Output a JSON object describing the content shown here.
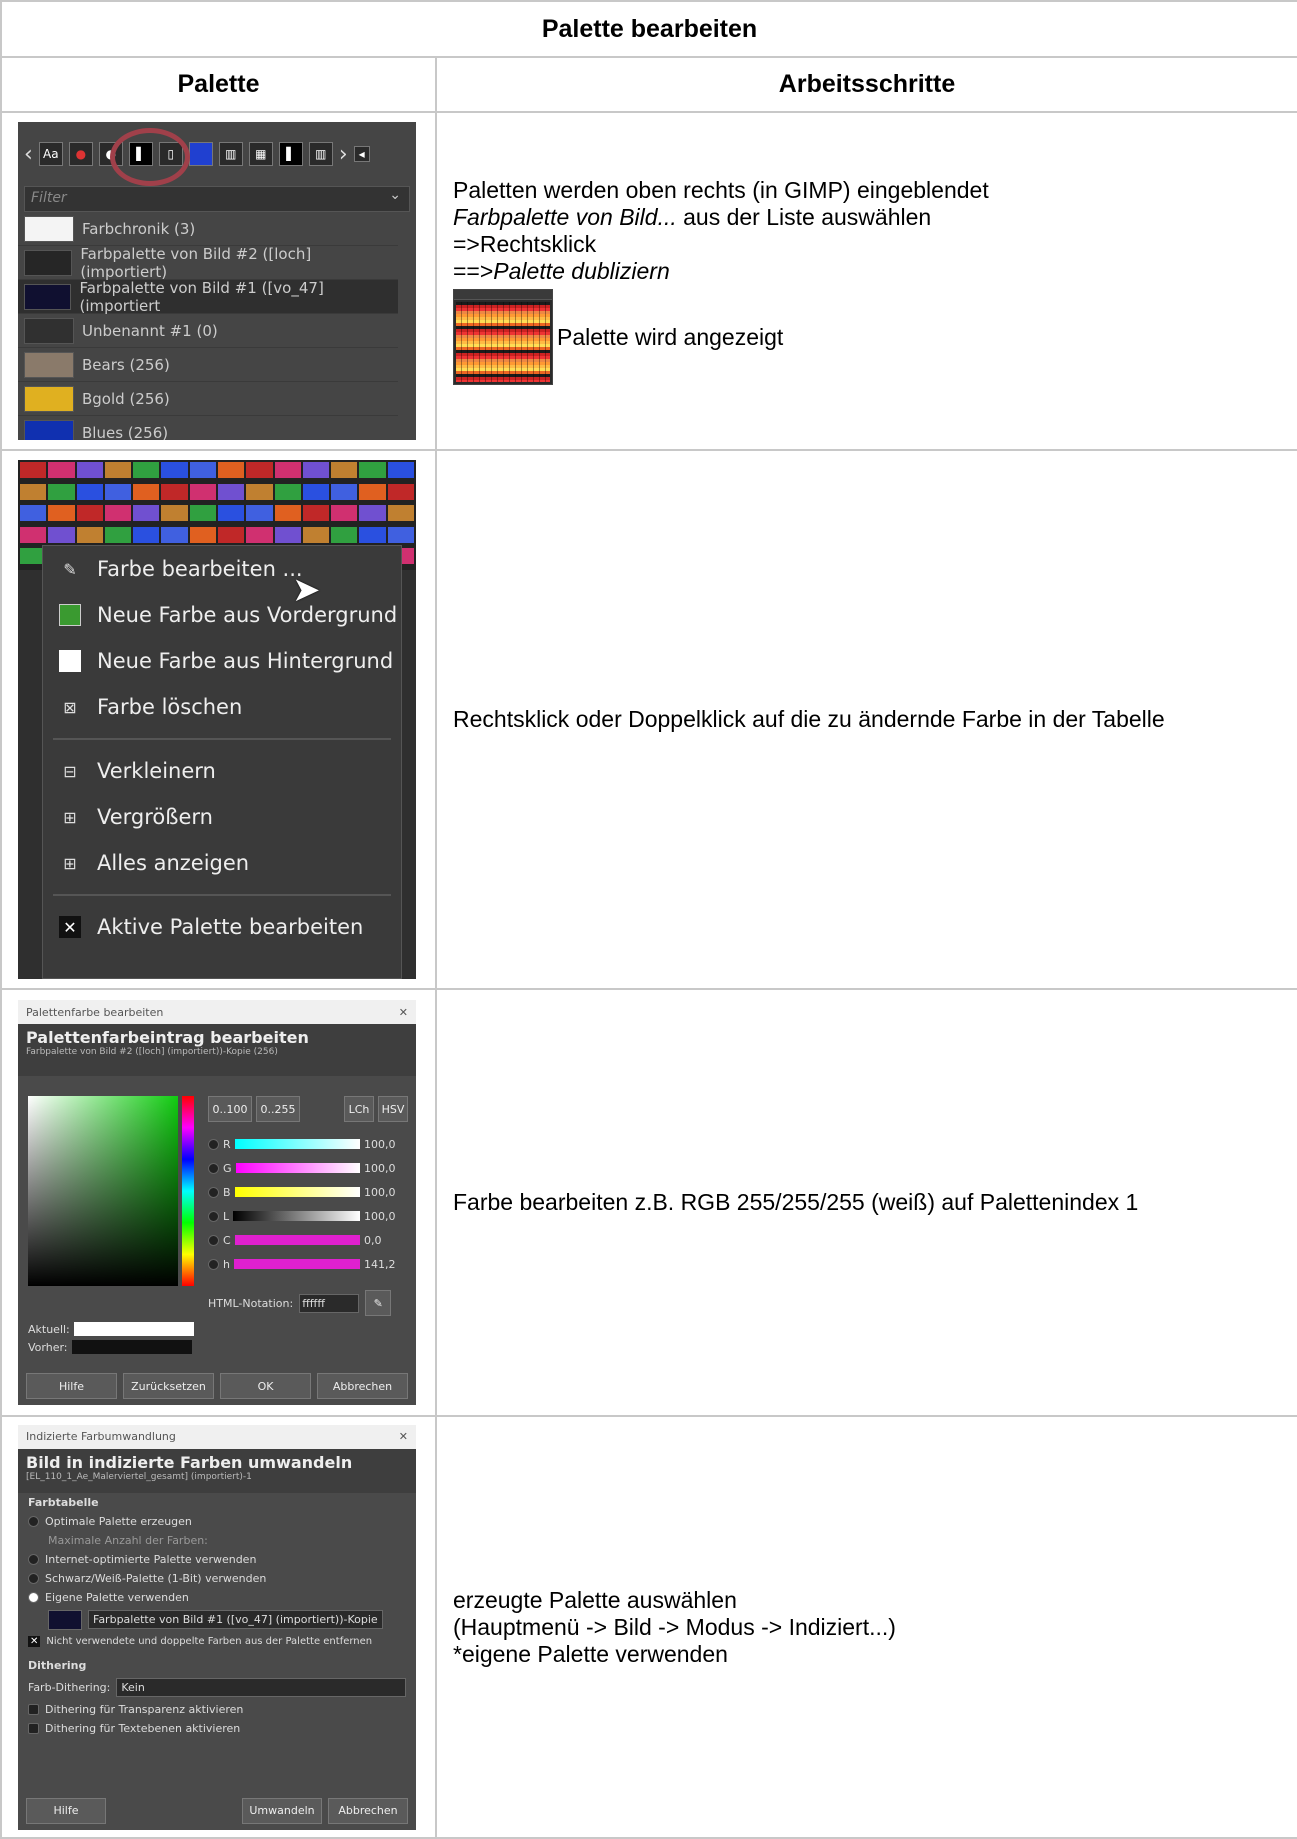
{
  "title": "Palette bearbeiten",
  "columns": {
    "left": "Palette",
    "right": "Arbeitsschritte"
  },
  "rows": [
    {
      "lines_a": [
        "Paletten werden oben rechts (in GIMP) eingeblendet"
      ],
      "line_italic": "Farbpalette von Bild...",
      "line_italic_rest": " aus der Liste auswählen",
      "line_rk": "=>Rechtsklick",
      "line_dup_prefix": "==>",
      "line_dup_italic": "Palette dubliziern",
      "line_shown": "Palette wird angezeigt"
    },
    {
      "text": "Rechtsklick oder Doppelklick auf die zu ändernde Farbe in der Tabelle"
    },
    {
      "text": "Farbe bearbeiten z.B. RGB 255/255/255 (weiß) auf Palettenindex 1"
    },
    {
      "lines": [
        "erzeugte Palette auswählen",
        "(Hauptmenü -> Bild -> Modus -> Indiziert...)",
        "*eigene Palette verwenden"
      ]
    }
  ],
  "shot1": {
    "filter_placeholder": "Filter",
    "items": [
      {
        "label": "Farbchronik (3)",
        "color": "#f4f4f4"
      },
      {
        "label": "Farbpalette von Bild #2 ([loch] (importiert)",
        "color": "#262626"
      },
      {
        "label": "Farbpalette von Bild #1 ([vo_47] (importiert",
        "color": "#101030"
      },
      {
        "label": "Unbenannt #1 (0)",
        "color": "#303030"
      },
      {
        "label": "Bears (256)",
        "color": "#8a7a6a"
      },
      {
        "label": "Bgold (256)",
        "color": "#e0b020"
      },
      {
        "label": "Blues (256)",
        "color": "#1030b0"
      }
    ]
  },
  "shot2": {
    "menu": [
      {
        "label": "Farbe bearbeiten ...",
        "icon": "edit-icon"
      },
      {
        "label": "Neue Farbe aus Vordergrund",
        "icon": "green-swatch-icon"
      },
      {
        "label": "Neue Farbe aus Hintergrund",
        "icon": "white-swatch-icon"
      },
      {
        "label": "Farbe löschen",
        "icon": "delete-icon"
      },
      {
        "label": "Verkleinern",
        "icon": "zoom-out-icon"
      },
      {
        "label": "Vergrößern",
        "icon": "zoom-in-icon"
      },
      {
        "label": "Alles anzeigen",
        "icon": "zoom-all-icon"
      },
      {
        "label": "Aktive Palette bearbeiten",
        "icon": "close-icon"
      }
    ]
  },
  "shot3": {
    "window_title": "Palettenfarbe bearbeiten",
    "heading": "Palettenfarbeintrag bearbeiten",
    "subheading": "Farbpalette von Bild #2 ([loch] (importiert))-Kopie (256)",
    "range_buttons": [
      "0..100",
      "0..255"
    ],
    "mode_buttons": [
      "LCh",
      "HSV"
    ],
    "sliders": [
      {
        "label": "R",
        "value": "100,0"
      },
      {
        "label": "G",
        "value": "100,0"
      },
      {
        "label": "B",
        "value": "100,0"
      },
      {
        "label": "L",
        "value": "100,0"
      },
      {
        "label": "C",
        "value": "0,0"
      },
      {
        "label": "h",
        "value": "141,2"
      }
    ],
    "html_label": "HTML-Notation:",
    "html_value": "ffffff",
    "current_label": "Aktuell:",
    "previous_label": "Vorher:",
    "buttons": [
      "Hilfe",
      "Zurücksetzen",
      "OK",
      "Abbrechen"
    ]
  },
  "shot4": {
    "window_title": "Indizierte Farbumwandlung",
    "heading": "Bild in indizierte Farben umwandeln",
    "subheading": "[EL_110_1_Ae_Malerviertel_gesamt] (importiert)-1",
    "section1": "Farbtabelle",
    "options": [
      "Optimale Palette erzeugen",
      "Maximale Anzahl der Farben:",
      "Internet-optimierte Palette verwenden",
      "Schwarz/Weiß-Palette (1-Bit) verwenden",
      "Eigene Palette verwenden"
    ],
    "palette_value": "Farbpalette von Bild #1 ([vo_47] (importiert))-Kopie",
    "remove_unused": "Nicht verwendete und doppelte Farben aus der Palette entfernen",
    "section2": "Dithering",
    "dither_label": "Farb-Dithering:",
    "dither_value": "Kein",
    "check1": "Dithering für Transparenz aktivieren",
    "check2": "Dithering für Textebenen aktivieren",
    "buttons": [
      "Hilfe",
      "Umwandeln",
      "Abbrechen"
    ]
  }
}
